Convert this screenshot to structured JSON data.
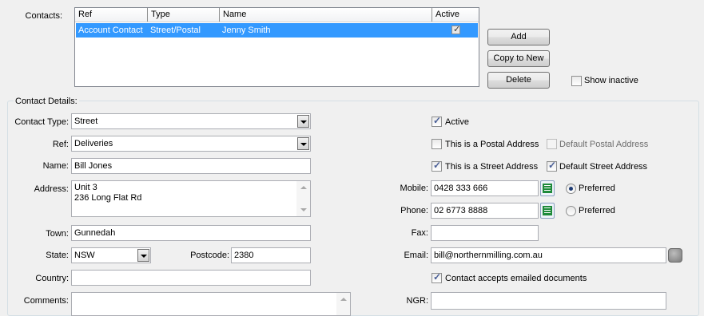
{
  "contacts": {
    "label": "Contacts:",
    "columns": [
      "Ref",
      "Type",
      "Name",
      "Active"
    ],
    "rows": [
      {
        "ref": "Account Contact",
        "type": "Street/Postal",
        "name": "Jenny Smith",
        "active": true
      }
    ],
    "buttons": {
      "add": "Add",
      "copy_to_new": "Copy to New",
      "delete": "Delete"
    },
    "show_inactive": {
      "label": "Show inactive",
      "checked": false
    }
  },
  "details": {
    "group_title": "Contact Details:",
    "contact_type": {
      "label": "Contact Type:",
      "value": "Street"
    },
    "ref": {
      "label": "Ref:",
      "value": "Deliveries"
    },
    "name": {
      "label": "Name:",
      "value": "Bill Jones"
    },
    "address": {
      "label": "Address:",
      "line1": "Unit 3",
      "line2": "236 Long Flat Rd"
    },
    "town": {
      "label": "Town:",
      "value": "Gunnedah"
    },
    "state": {
      "label": "State:",
      "value": "NSW"
    },
    "postcode": {
      "label": "Postcode:",
      "value": "2380"
    },
    "country": {
      "label": "Country:",
      "value": ""
    },
    "comments": {
      "label": "Comments:",
      "value": ""
    },
    "active": {
      "label": "Active",
      "checked": true
    },
    "is_postal": {
      "label": "This is a Postal Address",
      "checked": false
    },
    "default_postal": {
      "label": "Default Postal Address",
      "checked": false,
      "disabled": true
    },
    "is_street": {
      "label": "This is a Street Address",
      "checked": true
    },
    "default_street": {
      "label": "Default Street Address",
      "checked": true
    },
    "mobile": {
      "label": "Mobile:",
      "value": "0428 333 666",
      "preferred_label": "Preferred",
      "preferred": true
    },
    "phone": {
      "label": "Phone:",
      "value": "02 6773 8888",
      "preferred_label": "Preferred",
      "preferred": false
    },
    "fax": {
      "label": "Fax:",
      "value": ""
    },
    "email": {
      "label": "Email:",
      "value": "bill@northernmilling.com.au"
    },
    "accepts_email": {
      "label": "Contact accepts emailed documents",
      "checked": true
    },
    "ngr": {
      "label": "NGR:",
      "value": ""
    }
  },
  "colors": {
    "selection": "#3399ff",
    "background": "#f0f0f0"
  }
}
